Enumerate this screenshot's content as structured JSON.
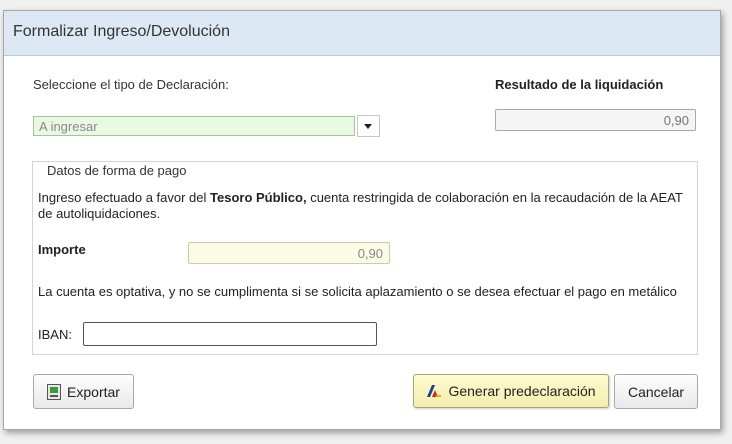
{
  "dialog": {
    "title": "Formalizar Ingreso/Devolución"
  },
  "declaration": {
    "label": "Seleccione el tipo de Declaración:",
    "selected": "A ingresar"
  },
  "result": {
    "label": "Resultado de la liquidación",
    "value": "0,90"
  },
  "payment": {
    "legend": "Datos de forma de pago",
    "info_prefix": "Ingreso efectuado a favor del",
    "info_bold": "Tesoro Público,",
    "info_suffix": "cuenta restringida de colaboración en la recaudación de la AEAT de autoliquidaciones.",
    "importe_label": "Importe",
    "importe_value": "0,90",
    "note": "La cuenta es optativa, y no se cumplimenta si se solicita aplazamiento o se desea efectuar el pago en metálico",
    "iban_label": "IBAN:",
    "iban_value": ""
  },
  "buttons": {
    "export": "Exportar",
    "generate": "Generar predeclaración",
    "cancel": "Cancelar"
  },
  "icons": {
    "export": "export-icon",
    "generate": "aeat-logo-icon",
    "dropdown": "chevron-down-icon"
  }
}
